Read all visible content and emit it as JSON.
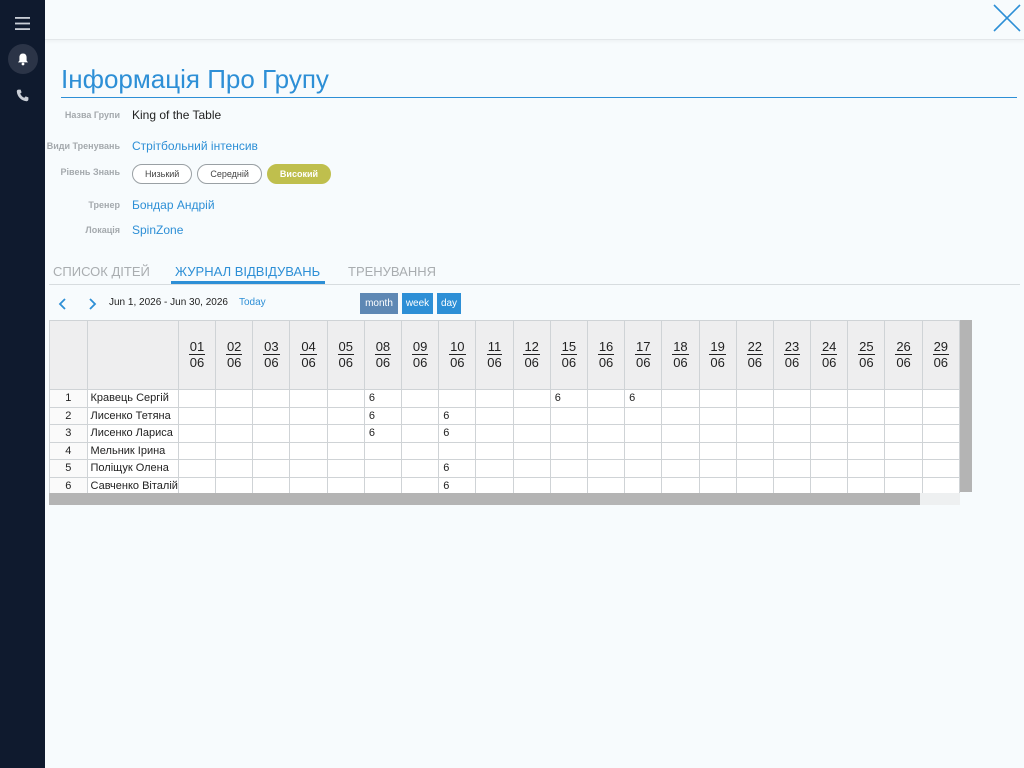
{
  "sidebar": {
    "menu_icon": "hamburger-icon",
    "bell_icon": "bell-icon",
    "phone_icon": "phone-icon"
  },
  "header": {
    "close_icon": "close-icon"
  },
  "page": {
    "title": "Інформація Про Групу"
  },
  "info": {
    "group_name_label": "Назва Групи",
    "group_name_value": "King of the Table",
    "training_type_label": "Види Тренувань",
    "training_type_value": "Стрітбольний інтенсив",
    "level_label": "Рівень Знань",
    "levels": [
      "Низький",
      "Середній",
      "Високий"
    ],
    "level_selected": "Високий",
    "coach_label": "Тренер",
    "coach_value": "Бондар Андрій",
    "location_label": "Локація",
    "location_value": "SpinZone"
  },
  "tabs": [
    "СПИСОК ДІТЕЙ",
    "ЖУРНАЛ ВІДВІДУВАНЬ",
    "ТРЕНУВАННЯ"
  ],
  "active_tab": "ЖУРНАЛ ВІДВІДУВАНЬ",
  "calendar": {
    "range": "Jun 1, 2026 - Jun 30, 2026",
    "today": "Today",
    "views": [
      "month",
      "week",
      "day"
    ],
    "active_view": "month",
    "days": [
      "01",
      "02",
      "03",
      "04",
      "05",
      "08",
      "09",
      "10",
      "11",
      "12",
      "15",
      "16",
      "17",
      "18",
      "19",
      "22",
      "23",
      "24",
      "25",
      "26",
      "29"
    ],
    "month": "06"
  },
  "attendance": {
    "rows": [
      {
        "num": "1",
        "name": "Кравець Сергій",
        "cells": [
          "",
          "",
          "",
          "",
          "",
          "6",
          "",
          "",
          "",
          "",
          "6",
          "",
          "6",
          "",
          "",
          "",
          "",
          "",
          "",
          "",
          ""
        ]
      },
      {
        "num": "2",
        "name": "Лисенко  Тетяна",
        "cells": [
          "",
          "",
          "",
          "",
          "",
          "6",
          "",
          "6",
          "",
          "",
          "",
          "",
          "",
          "",
          "",
          "",
          "",
          "",
          "",
          "",
          ""
        ]
      },
      {
        "num": "3",
        "name": "Лисенко Лариса",
        "cells": [
          "",
          "",
          "",
          "",
          "",
          "6",
          "",
          "6",
          "",
          "",
          "",
          "",
          "",
          "",
          "",
          "",
          "",
          "",
          "",
          "",
          ""
        ]
      },
      {
        "num": "4",
        "name": "Мельник  Ірина",
        "cells": [
          "",
          "",
          "",
          "",
          "",
          "",
          "",
          "",
          "",
          "",
          "",
          "",
          "",
          "",
          "",
          "",
          "",
          "",
          "",
          "",
          ""
        ]
      },
      {
        "num": "5",
        "name": "Поліщук Олена",
        "cells": [
          "",
          "",
          "",
          "",
          "",
          "",
          "",
          "6",
          "",
          "",
          "",
          "",
          "",
          "",
          "",
          "",
          "",
          "",
          "",
          "",
          ""
        ]
      },
      {
        "num": "6",
        "name": "Савченко Віталій",
        "cells": [
          "",
          "",
          "",
          "",
          "",
          "",
          "",
          "6",
          "",
          "",
          "",
          "",
          "",
          "",
          "",
          "",
          "",
          "",
          "",
          "",
          ""
        ]
      }
    ]
  },
  "colors": {
    "accent": "#2d8fd6",
    "sidebar_bg": "#0f1a2e",
    "level_active": "#bfbf4d",
    "month_button": "#5e88b4"
  }
}
